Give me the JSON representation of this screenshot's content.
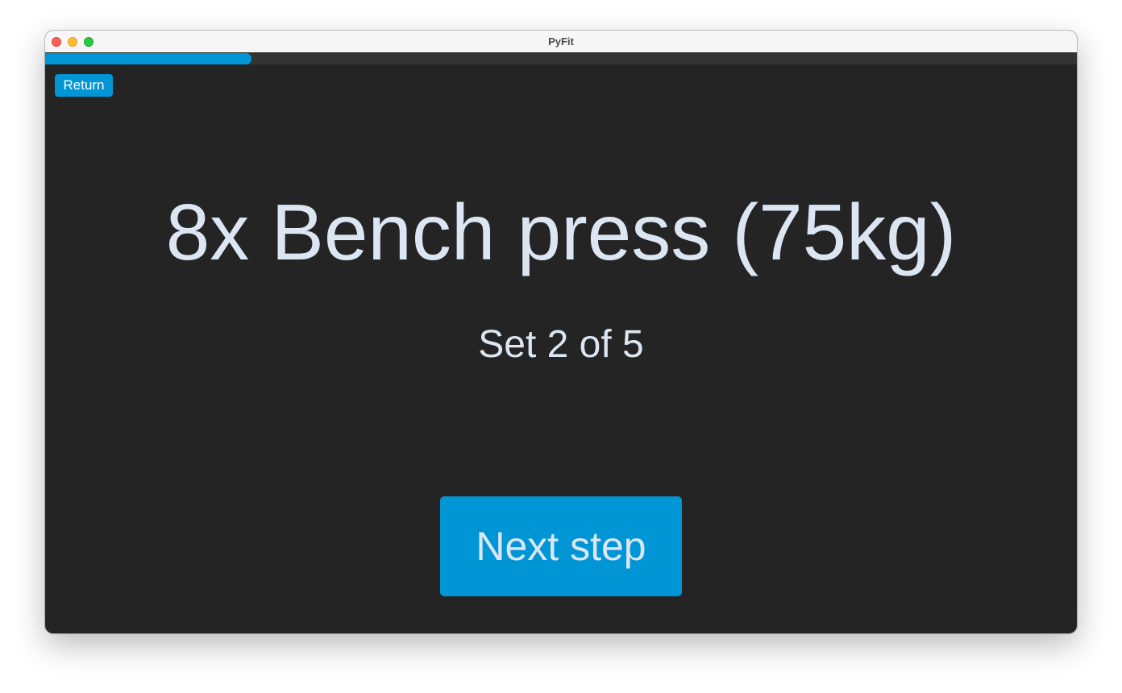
{
  "window": {
    "title": "PyFit"
  },
  "progress": {
    "fraction": 0.2,
    "accent_color": "#0096d6",
    "track_color": "#333333"
  },
  "toolbar": {
    "return_label": "Return"
  },
  "workout": {
    "exercise": "8x Bench press (75kg)",
    "set_counter": "Set 2 of 5"
  },
  "actions": {
    "next_label": "Next step"
  },
  "colors": {
    "background": "#242424",
    "text": "#dce6f2",
    "accent": "#0096d6"
  }
}
